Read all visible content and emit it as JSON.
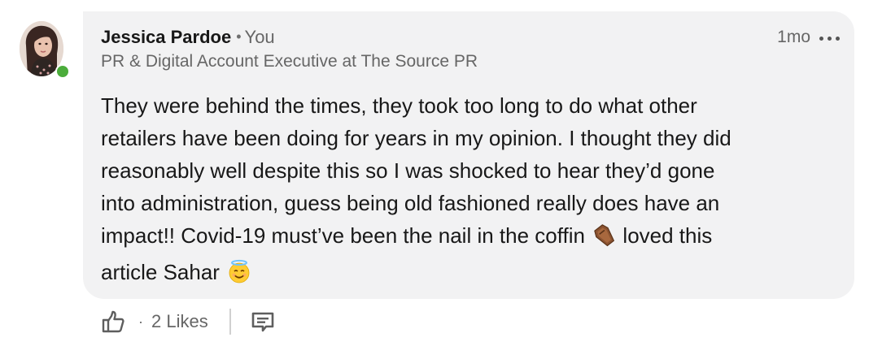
{
  "comment": {
    "author": {
      "name": "Jessica Pardoe",
      "separator": "•",
      "relation": "You",
      "headline": "PR & Digital Account Executive at The Source PR",
      "online": true
    },
    "timestamp": "1mo",
    "more_icon": "ellipsis-horizontal-icon",
    "body_lines": [
      "They were behind the times, they took too long to do what other",
      "retailers have been doing for years in my opinion. I thought they did",
      "reasonably well despite this so I was shocked to hear they’d gone",
      "into administration, guess being old fashioned really does have an",
      "impact!! Covid-19 must’ve been the nail in the coffin",
      "loved this",
      "article Sahar"
    ],
    "emojis": [
      "coffin-emoji",
      "smiling-face-with-halo-emoji"
    ]
  },
  "actions": {
    "like_icon": "thumbs-up-icon",
    "separator": "·",
    "likes_label": "2 Likes",
    "reply_icon": "comment-icon"
  },
  "colors": {
    "bubble_bg": "#f2f2f3",
    "presence": "#4bac3b",
    "secondary_text": "#666666"
  }
}
